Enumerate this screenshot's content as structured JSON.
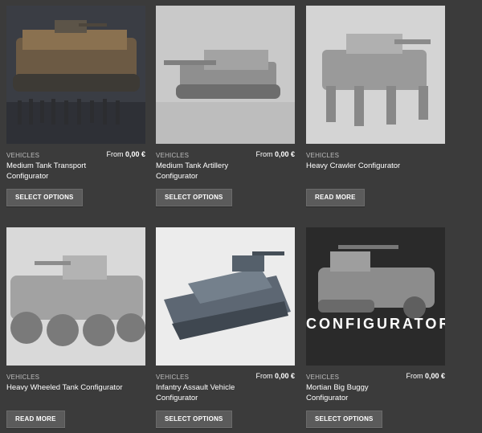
{
  "products": [
    {
      "category": "VEHICLES",
      "title": "Medium Tank Transport Configurator",
      "price_prefix": "From",
      "price": "0,00 €",
      "button": "SELECT OPTIONS"
    },
    {
      "category": "VEHICLES",
      "title": "Medium Tank Artillery Configurator",
      "price_prefix": "From",
      "price": "0,00 €",
      "button": "SELECT OPTIONS"
    },
    {
      "category": "VEHICLES",
      "title": "Heavy Crawler Configurator",
      "price_prefix": "",
      "price": "",
      "button": "READ MORE"
    },
    {
      "category": "VEHICLES",
      "title": "Heavy Wheeled Tank Configurator",
      "price_prefix": "",
      "price": "",
      "button": "READ MORE"
    },
    {
      "category": "VEHICLES",
      "title": "Infantry Assault Vehicle Configurator",
      "price_prefix": "From",
      "price": "0,00 €",
      "button": "SELECT OPTIONS"
    },
    {
      "category": "VEHICLES",
      "title": "Mortian Big Buggy Configurator",
      "price_prefix": "From",
      "price": "0,00 €",
      "button": "SELECT OPTIONS",
      "image_overlay": "CONFIGURATOR"
    }
  ],
  "colors": {
    "page_bg": "#3b3b3b",
    "button_bg": "#5b5b5b",
    "category_text": "#bdbdbd"
  }
}
